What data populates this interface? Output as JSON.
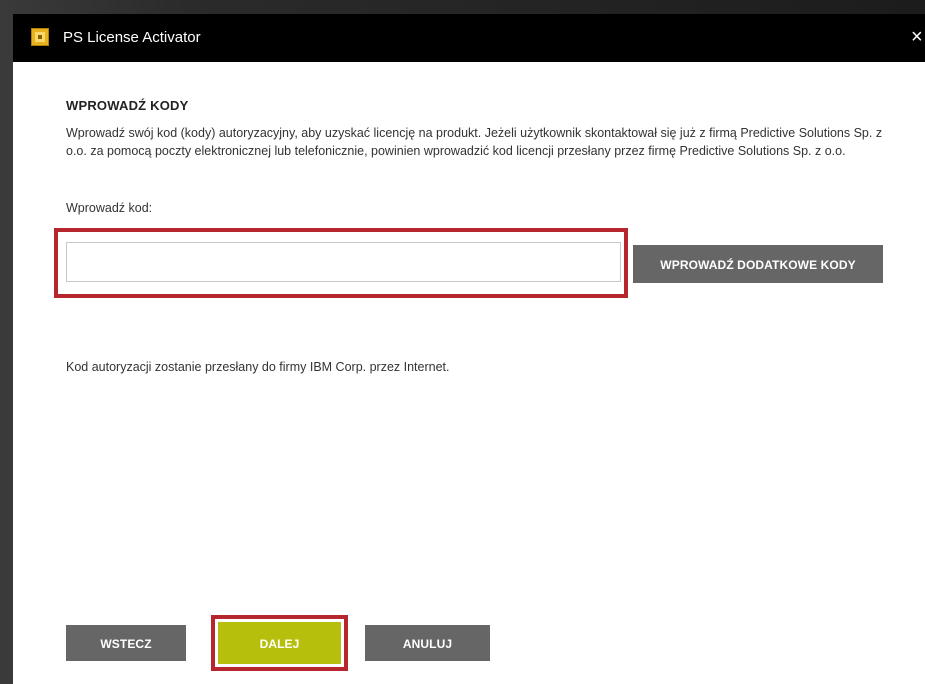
{
  "window": {
    "title": "PS License Activator",
    "icon": "license-app-icon",
    "close_glyph": "×"
  },
  "page": {
    "heading": "WPROWADŹ KODY",
    "description": "Wprowadź swój kod (kody) autoryzacyjny, aby uzyskać licencję na produkt. Jeżeli użytkownik skontaktował się już z firmą Predictive Solutions Sp. z o.o. za pomocą poczty elektronicznej lub telefonicznie, powinien wprowadzić kod licencji przesłany przez firmę Predictive Solutions Sp. z o.o.",
    "code_label": "Wprowadź kod:",
    "code_value": "",
    "code_placeholder": "",
    "extra_codes_button": "WPROWADŹ DODATKOWE KODY",
    "info_text": "Kod autoryzacji zostanie przesłany do firmy IBM Corp. przez Internet."
  },
  "footer": {
    "back_label": "WSTECZ",
    "next_label": "DALEJ",
    "cancel_label": "ANULUJ"
  },
  "colors": {
    "titlebar": "#000000",
    "button_gray": "#666666",
    "button_next": "#b6bf0b",
    "highlight_red": "#b5262d"
  }
}
